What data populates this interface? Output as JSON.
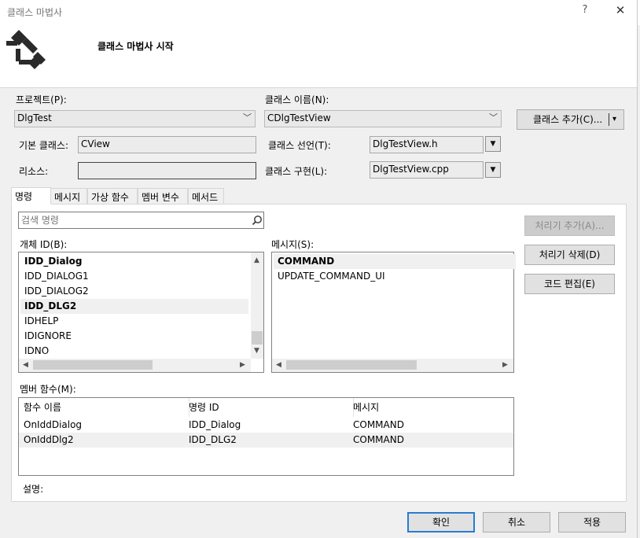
{
  "window": {
    "title": "클래스 마법사",
    "help": "?",
    "close": "✕"
  },
  "header": {
    "title": "클래스 마법사 시작"
  },
  "project": {
    "label": "프로젝트(P):",
    "value": "DlgTest"
  },
  "class_name": {
    "label": "클래스 이름(N):",
    "value": "CDlgTestView"
  },
  "add_class_button": {
    "label": "클래스 추가(C)...",
    "arrow": "▾"
  },
  "base_class": {
    "label": "기본 클래스:",
    "value": "CView"
  },
  "class_decl": {
    "label": "클래스 선언(T):",
    "value": "DlgTestView.h"
  },
  "resource": {
    "label": "리소스:",
    "value": ""
  },
  "class_impl": {
    "label": "클래스 구현(L):",
    "value": "DlgTestView.cpp"
  },
  "tabs": [
    {
      "label": "명령"
    },
    {
      "label": "메시지"
    },
    {
      "label": "가상 함수"
    },
    {
      "label": "멤버 변수"
    },
    {
      "label": "메서드"
    }
  ],
  "search": {
    "placeholder": "검색 명령"
  },
  "object_ids": {
    "label": "개체 ID(B):",
    "items": [
      {
        "text": "IDD_Dialog",
        "bold": true
      },
      {
        "text": "IDD_DIALOG1",
        "bold": false
      },
      {
        "text": "IDD_DIALOG2",
        "bold": false
      },
      {
        "text": "IDD_DLG2",
        "bold": true
      },
      {
        "text": "IDHELP",
        "bold": false
      },
      {
        "text": "IDIGNORE",
        "bold": false
      },
      {
        "text": "IDNO",
        "bold": false
      }
    ]
  },
  "messages": {
    "label": "메시지(S):",
    "items": [
      {
        "text": "COMMAND",
        "bold": true
      },
      {
        "text": "UPDATE_COMMAND_UI",
        "bold": false
      }
    ]
  },
  "handler_buttons": {
    "add": "처리기 추가(A)...",
    "delete": "처리기 삭제(D)",
    "edit": "코드 편집(E)"
  },
  "member_functions": {
    "label": "멤버 함수(M):",
    "columns": [
      "함수 이름",
      "명령 ID",
      "메시지"
    ],
    "rows": [
      [
        "OnIddDialog",
        "IDD_Dialog",
        "COMMAND"
      ],
      [
        "OnIddDlg2",
        "IDD_DLG2",
        "COMMAND"
      ]
    ]
  },
  "description": {
    "label": "설명:"
  },
  "footer": {
    "ok": "확인",
    "cancel": "취소",
    "apply": "적용"
  }
}
